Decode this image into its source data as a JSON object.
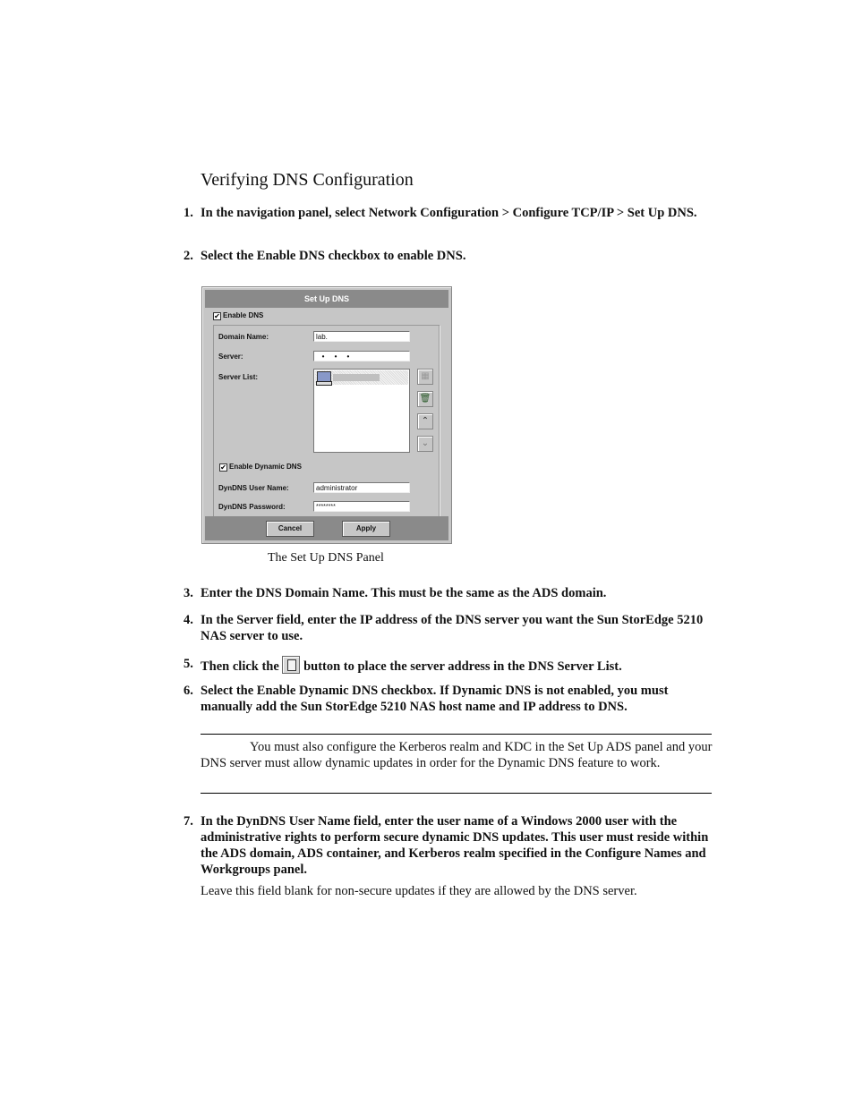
{
  "doc": {
    "section_title": "Verifying DNS Configuration",
    "steps": [
      {
        "num": "1.",
        "text": "In the navigation panel, select Network Configuration > Configure TCP/IP > Set Up DNS."
      },
      {
        "num": "2.",
        "text": "Select the Enable DNS checkbox to enable DNS."
      },
      {
        "num": "3.",
        "text": "Enter the DNS Domain Name. This must be the same as the ADS domain."
      },
      {
        "num": "4.",
        "text": "In the Server field, enter the IP address of the DNS server you want the Sun StorEdge 5210 NAS server to use."
      },
      {
        "num": "5.",
        "text_before": "Then click the",
        "icon": "add-server-icon",
        "text_after": "button to place the server address in the DNS Server List."
      },
      {
        "num": "6.",
        "text": "Select the Enable Dynamic DNS checkbox. If Dynamic DNS is not enabled, you must manually add the Sun StorEdge 5210 NAS host name and IP address to DNS."
      },
      {
        "num": "7.",
        "text": "In the DynDNS User Name field, enter the user name of a Windows 2000 user with the administrative rights to perform secure dynamic DNS updates. This user must reside within the ADS domain, ADS container, and Kerberos realm specified in the Configure Names and Workgroups panel."
      }
    ],
    "figure_caption": "The Set Up DNS Panel",
    "note": "You must also configure the Kerberos realm and KDC in the Set Up ADS panel and your DNS server must allow dynamic updates in order for the Dynamic DNS feature to work.",
    "step7_followup": "Leave this field blank for non-secure updates if they are allowed by the DNS server."
  },
  "panel": {
    "title": "Set Up DNS",
    "enable_dns_label": "Enable DNS",
    "enable_dns_checked": true,
    "domain_name_label": "Domain Name:",
    "domain_name_value": "lab.",
    "server_label": "Server:",
    "server_value": "   •     •     •",
    "server_list_label": "Server List:",
    "server_list_items": [
      "·"
    ],
    "enable_dynamic_label": "Enable Dynamic DNS",
    "enable_dynamic_checked": true,
    "dyn_user_label": "DynDNS User Name:",
    "dyn_user_value": "administrator",
    "dyn_password_label": "DynDNS Password:",
    "dyn_password_value": "********",
    "cancel_label": "Cancel",
    "apply_label": "Apply",
    "check_mark": "✔",
    "side_buttons": [
      "add-server-icon",
      "trash-icon",
      "move-up-icon",
      "move-down-icon"
    ]
  }
}
